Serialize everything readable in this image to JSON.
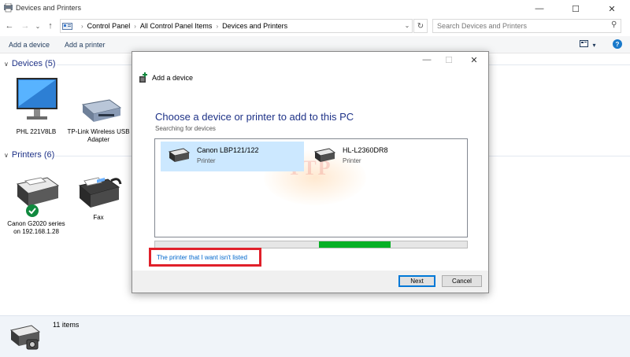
{
  "window": {
    "title": "Devices and Printers",
    "minimize": "—",
    "maximize": "☐",
    "close": "✕"
  },
  "nav": {
    "back": "←",
    "forward": "→",
    "recent": "⌄",
    "up": "↑",
    "breadcrumbs": [
      "Control Panel",
      "All Control Panel Items",
      "Devices and Printers"
    ],
    "breadcrumb_separator": "›",
    "dropdown": "⌄",
    "refresh": "↻"
  },
  "search": {
    "placeholder": "Search Devices and Printers",
    "icon": "⚲"
  },
  "commands": {
    "add_device": "Add a device",
    "add_printer": "Add a printer",
    "view": "▾",
    "help": "?"
  },
  "devices_section": {
    "title": "Devices (5)",
    "chevron": "∨",
    "items": [
      {
        "label": "PHL 221V8LB",
        "icon": "monitor-icon"
      },
      {
        "label": "TP-Link Wireless USB Adapter",
        "icon": "usb-adapter-icon"
      }
    ]
  },
  "printers_section": {
    "title": "Printers (6)",
    "chevron": "∨",
    "items": [
      {
        "label": "Canon G2020 series on 192.168.1.28",
        "icon": "printer-icon",
        "default": true
      },
      {
        "label": "Fax",
        "icon": "fax-icon"
      }
    ]
  },
  "status_bar": {
    "count": "11 items"
  },
  "dialog": {
    "window_title": "Add a device",
    "minimize": "—",
    "maximize": "☐",
    "close": "✕",
    "heading": "Choose a device or printer to add to this PC",
    "status": "Searching for devices",
    "devices": [
      {
        "name": "Canon LBP121/122",
        "type": "Printer",
        "selected": true
      },
      {
        "name": "HL-L2360DR8",
        "type": "Printer",
        "selected": false
      }
    ],
    "progress_fraction": 0.23,
    "not_listed_link": "The printer that I want isn't listed",
    "next_button": "Next",
    "cancel_button": "Cancel",
    "watermark": "TTP"
  },
  "colors": {
    "accent": "#1e3287",
    "link": "#0066cc",
    "highlight": "#e0202a",
    "progress": "#06b025",
    "selection": "#cce8ff"
  }
}
